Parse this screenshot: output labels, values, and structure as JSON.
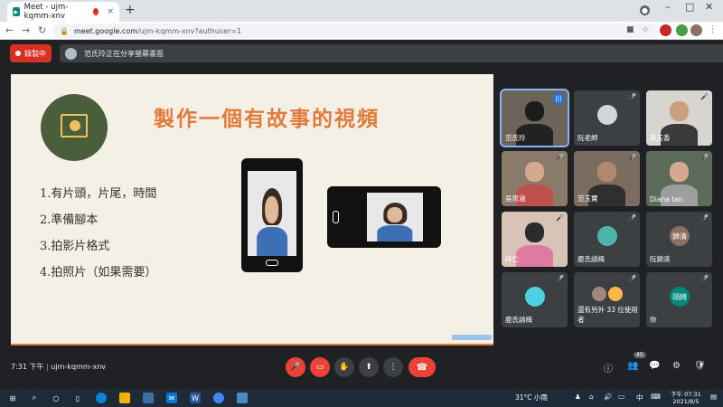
{
  "browser": {
    "tab_title": "Meet - ujm-kqmm-xnv",
    "tab_close": "×",
    "new_tab": "+",
    "url_host": "meet.google.com",
    "url_path": "/ujm-kqmm-xnv?authuser=1"
  },
  "meet": {
    "recording_label": "錄製中",
    "presenting_text": "范氏玲正在分享螢幕畫面",
    "meeting_time": "7:31 下午",
    "meeting_code": "ujm-kqmm-xnv",
    "participant_count": "45"
  },
  "slide": {
    "title": "製作一個有故事的視頻",
    "bullets": [
      "1.有片頭，片尾，時間",
      "2.準備腳本",
      "3.拍影片格式",
      "4.拍照片（如果需要）"
    ]
  },
  "participants": [
    {
      "name": "范氏玲",
      "status": "speaking"
    },
    {
      "name": "阮老師",
      "status": "muted"
    },
    {
      "name": "黃玉香",
      "status": "muted"
    },
    {
      "name": "吳思涵",
      "status": "muted"
    },
    {
      "name": "范玉寶",
      "status": "muted"
    },
    {
      "name": "Diana tan",
      "status": "muted"
    },
    {
      "name": "梓仁",
      "status": "muted"
    },
    {
      "name": "鹿氏請梅",
      "status": "muted"
    },
    {
      "name": "阮錦清",
      "status": "muted",
      "initials": "錦清"
    },
    {
      "name": "鹿氏請梅",
      "status": "muted"
    },
    {
      "name": "還有另外 33 位使用者",
      "status": "muted"
    },
    {
      "name": "你",
      "status": "muted",
      "initials": "翊綺"
    }
  ],
  "taskbar": {
    "weather": "31°C 小雨",
    "ime": "中",
    "time": "下午 07:31",
    "date": "2021/8/5"
  },
  "colors": {
    "record_red": "#d93025",
    "slide_orange": "#e07b39",
    "meet_bg": "#202124"
  }
}
